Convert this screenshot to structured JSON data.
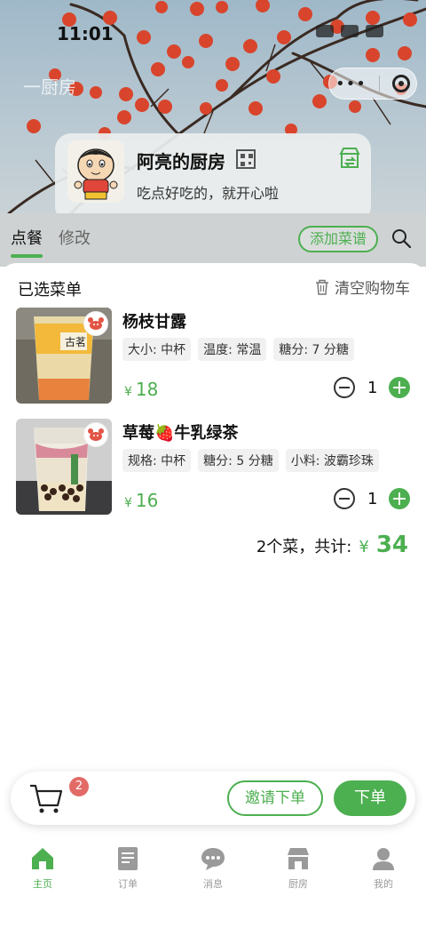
{
  "status_bar": {
    "time": "11:01"
  },
  "header": {
    "page_name": "一厨房",
    "mp_menu_icon": "more-dots-icon",
    "mp_close_icon": "target-close-icon"
  },
  "kitchen": {
    "name": "阿亮的厨房",
    "slogan": "吃点好吃的，就开心啦",
    "qr_icon": "qr-code-icon",
    "switch_icon": "store-switch-icon"
  },
  "tabs": {
    "items": [
      {
        "label": "点餐",
        "active": true
      },
      {
        "label": "修改",
        "active": false
      }
    ],
    "add_recipe_label": "添加菜谱",
    "accent": "#4caf50"
  },
  "cart": {
    "title": "已选菜单",
    "clear_label": "清空购物车",
    "items": [
      {
        "name": "杨枝甘露",
        "specs": [
          "大小: 中杯",
          "温度: 常温",
          "糖分: 7 分糖"
        ],
        "currency": "¥",
        "price": "18",
        "qty": "1"
      },
      {
        "name": "草莓🍓牛乳绿茶",
        "specs": [
          "规格: 中杯",
          "糖分: 5 分糖",
          "小料: 波霸珍珠"
        ],
        "currency": "¥",
        "price": "16",
        "qty": "1"
      }
    ],
    "total_count_label": "2个菜，共计:",
    "total_currency": "¥",
    "total_amount": "34"
  },
  "checkout": {
    "badge": "2",
    "invite_label": "邀请下单",
    "order_label": "下单"
  },
  "nav": {
    "items": [
      {
        "label": "主页",
        "icon": "home-icon",
        "active": true
      },
      {
        "label": "订单",
        "icon": "orders-icon",
        "active": false
      },
      {
        "label": "消息",
        "icon": "message-icon",
        "active": false
      },
      {
        "label": "厨房",
        "icon": "kitchen-icon",
        "active": false
      },
      {
        "label": "我的",
        "icon": "profile-icon",
        "active": false
      }
    ]
  }
}
